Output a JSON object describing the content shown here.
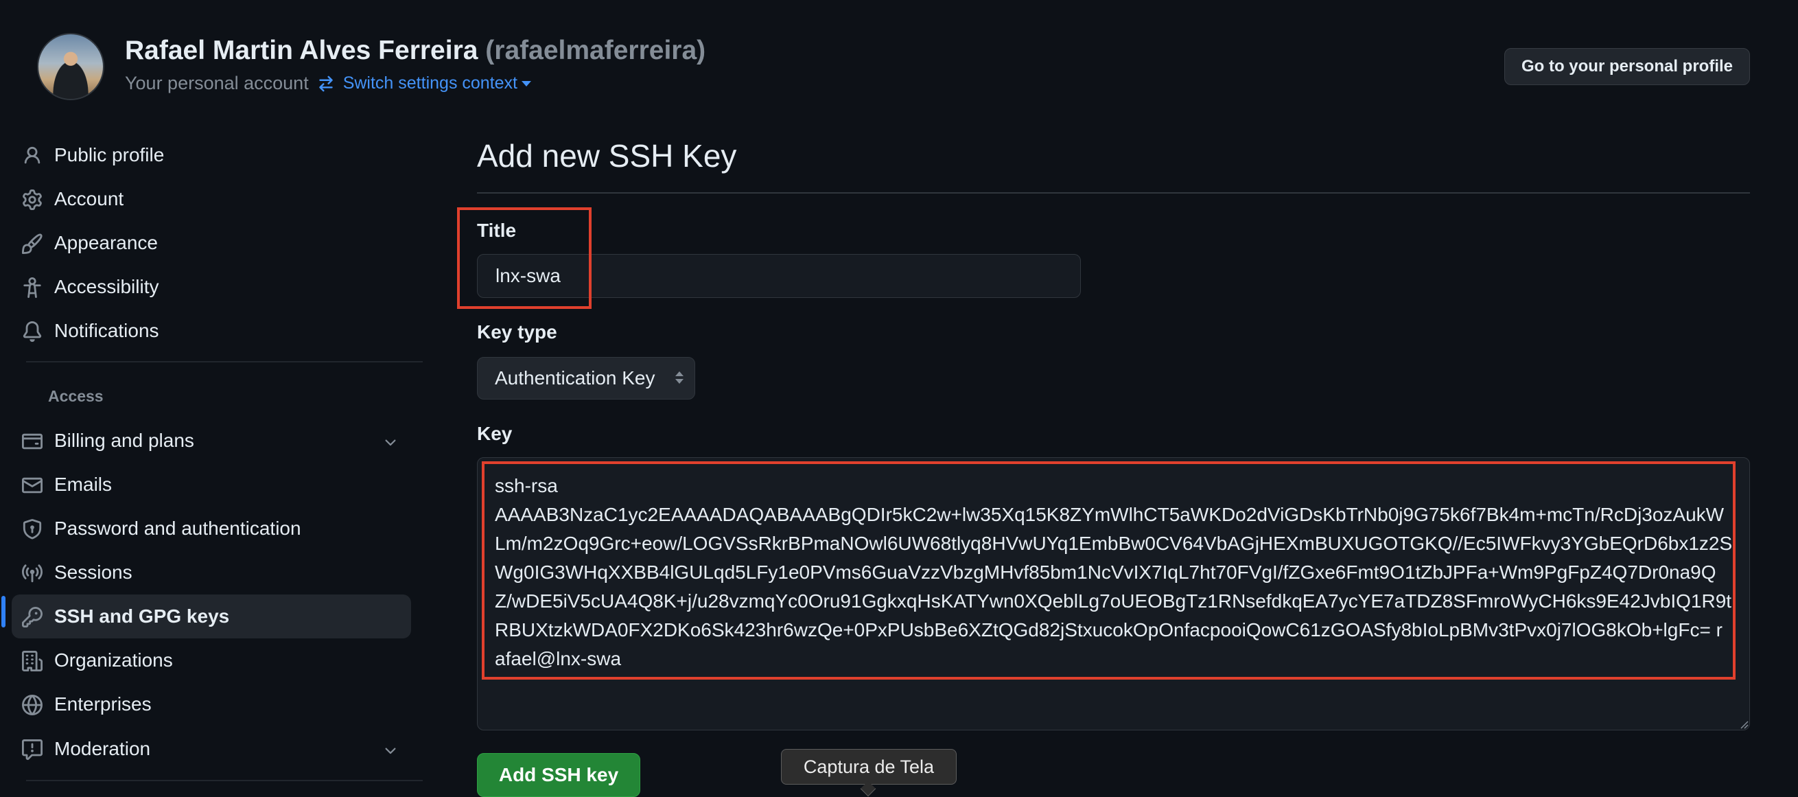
{
  "header": {
    "user_name": "Rafael Martin Alves Ferreira",
    "user_handle": "(rafaelmaferreira)",
    "account_label": "Your personal account",
    "switch_context": "Switch settings context",
    "profile_button": "Go to your personal profile"
  },
  "sidebar": {
    "items": [
      {
        "label": "Public profile",
        "icon": "person-icon"
      },
      {
        "label": "Account",
        "icon": "gear-icon"
      },
      {
        "label": "Appearance",
        "icon": "paintbrush-icon"
      },
      {
        "label": "Accessibility",
        "icon": "accessibility-icon"
      },
      {
        "label": "Notifications",
        "icon": "bell-icon"
      }
    ],
    "access_section": "Access",
    "access_items": [
      {
        "label": "Billing and plans",
        "icon": "credit-card-icon",
        "expandable": true
      },
      {
        "label": "Emails",
        "icon": "mail-icon"
      },
      {
        "label": "Password and authentication",
        "icon": "shield-lock-icon"
      },
      {
        "label": "Sessions",
        "icon": "broadcast-icon"
      },
      {
        "label": "SSH and GPG keys",
        "icon": "key-icon",
        "active": true
      },
      {
        "label": "Organizations",
        "icon": "organization-icon"
      },
      {
        "label": "Enterprises",
        "icon": "globe-icon"
      },
      {
        "label": "Moderation",
        "icon": "report-icon",
        "expandable": true
      }
    ]
  },
  "main": {
    "page_title": "Add new SSH Key",
    "title_label": "Title",
    "title_value": "lnx-swa",
    "key_type_label": "Key type",
    "key_type_value": "Authentication Key",
    "key_label": "Key",
    "key_value": "ssh-rsa\nAAAAB3NzaC1yc2EAAAADAQABAAABgQDIr5kC2w+lw35Xq15K8ZYmWlhCT5aWKDo2dViGDsKbTrNb0j9G75k6f7Bk4m+mcTn/RcDj3ozAukWLm/m2zOq9Grc+eow/LOGVSsRkrBPmaNOwl6UW68tlyq8HVwUYq1EmbBw0CV64VbAGjHEXmBUXUGOTGKQ//Ec5IWFkvy3YGbEQrD6bx1z2SWg0IG3WHqXXBB4lGULqd5LFy1e0PVms6GuaVzzVbzgMHvf85bm1NcVvIX7IqL7ht70FVgI/fZGxe6Fmt9O1tZbJPFa+Wm9PgFpZ4Q7Dr0na9QZ/wDE5iV5cUA4Q8K+j/u28vzmqYc0Oru91GgkxqHsKATYwn0XQeblLg7oUEOBgTz1RNsefdkqEA7ycYE7aTDZ8SFmroWyCH6ks9E42JvbIQ1R9tRBUXtzkWDA0FX2DKo6Sk423hr6wzQe+0PxPUsbBe6XZtQGd82jStxucokOpOnfacpooiQowC61zGOASfy8bIoLpBMv3tPvx0j7lOG8kOb+lgFc= rafael@lnx-swa",
    "add_button": "Add SSH key"
  },
  "tooltip": "Captura de Tela",
  "colors": {
    "background": "#0d1117",
    "link": "#4493f8",
    "primary_button": "#238636",
    "highlight": "#e0402d",
    "active_indicator": "#2f81f7"
  }
}
